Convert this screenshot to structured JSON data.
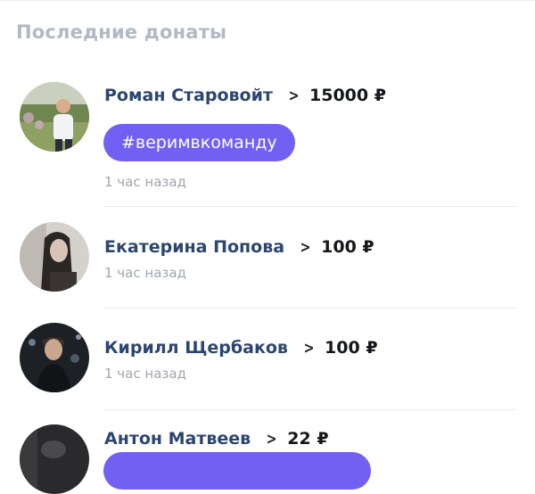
{
  "section": {
    "title": "Последние донаты"
  },
  "donations": [
    {
      "name": "Роман Старовойт",
      "amount": "15000 ₽",
      "tag": "#веримвкоманду",
      "time": "1 час назад",
      "avatar": "avatar-photo"
    },
    {
      "name": "Екатерина Попова",
      "amount": "100 ₽",
      "time": "1 час назад",
      "avatar": "avatar-photo"
    },
    {
      "name": "Кирилл Щербаков",
      "amount": "100 ₽",
      "time": "1 час назад",
      "avatar": "avatar-photo"
    },
    {
      "name": "Антон Матвеев",
      "amount": "22 ₽",
      "avatar": "avatar-photo"
    }
  ],
  "icons": {
    "chevron": "chevron-right-icon"
  },
  "colors": {
    "accent": "#7160f2",
    "name": "#2c4670",
    "muted": "#a0a6b0",
    "title": "#b3b8c2"
  }
}
